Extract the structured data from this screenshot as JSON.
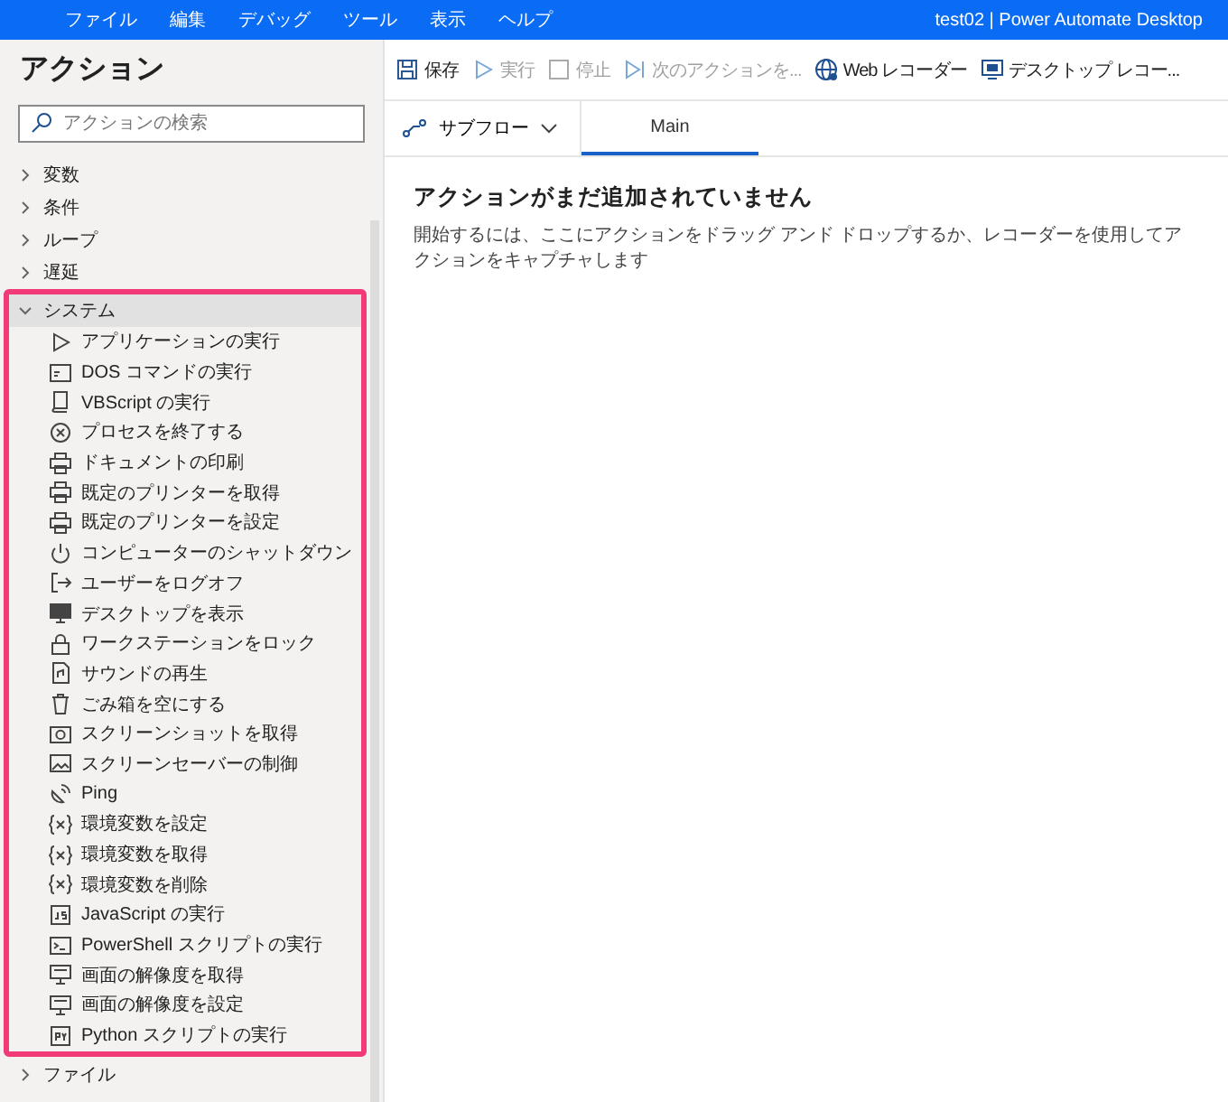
{
  "menu_bar": {
    "items": [
      "ファイル",
      "編集",
      "デバッグ",
      "ツール",
      "表示",
      "ヘルプ"
    ],
    "title": "test02 | Power Automate Desktop"
  },
  "sidebar": {
    "title": "アクション",
    "search": {
      "placeholder": "アクションの検索"
    },
    "categories": [
      {
        "label": "変数",
        "expanded": false,
        "highlighted": false
      },
      {
        "label": "条件",
        "expanded": false,
        "highlighted": false
      },
      {
        "label": "ループ",
        "expanded": false,
        "highlighted": false
      },
      {
        "label": "遅延",
        "expanded": false,
        "highlighted": false
      },
      {
        "label": "システム",
        "expanded": true,
        "highlighted": true,
        "children": [
          {
            "label": "アプリケーションの実行",
            "kind": "play"
          },
          {
            "label": "DOS コマンドの実行",
            "kind": "cmd"
          },
          {
            "label": "VBScript の実行",
            "kind": "script"
          },
          {
            "label": "プロセスを終了する",
            "kind": "close"
          },
          {
            "label": "ドキュメントの印刷",
            "kind": "printer"
          },
          {
            "label": "既定のプリンターを取得",
            "kind": "printer"
          },
          {
            "label": "既定のプリンターを設定",
            "kind": "printer"
          },
          {
            "label": "コンピューターのシャットダウン",
            "kind": "power"
          },
          {
            "label": "ユーザーをログオフ",
            "kind": "logout"
          },
          {
            "label": "デスクトップを表示",
            "kind": "monitor"
          },
          {
            "label": "ワークステーションをロック",
            "kind": "lock"
          },
          {
            "label": "サウンドの再生",
            "kind": "sound"
          },
          {
            "label": "ごみ箱を空にする",
            "kind": "trash"
          },
          {
            "label": "スクリーンショットを取得",
            "kind": "camera"
          },
          {
            "label": "スクリーンセーバーの制御",
            "kind": "image"
          },
          {
            "label": "Ping",
            "kind": "ping"
          },
          {
            "label": "環境変数を設定",
            "kind": "var"
          },
          {
            "label": "環境変数を取得",
            "kind": "var"
          },
          {
            "label": "環境変数を削除",
            "kind": "var"
          },
          {
            "label": "JavaScript の実行",
            "kind": "js"
          },
          {
            "label": "PowerShell スクリプトの実行",
            "kind": "terminal"
          },
          {
            "label": "画面の解像度を取得",
            "kind": "screen"
          },
          {
            "label": "画面の解像度を設定",
            "kind": "screen"
          },
          {
            "label": "Python スクリプトの実行",
            "kind": "py"
          }
        ]
      },
      {
        "label": "ファイル",
        "expanded": false,
        "highlighted": false
      }
    ]
  },
  "toolbar": [
    {
      "label": "保存",
      "kind": "save",
      "disabled": false
    },
    {
      "label": "実行",
      "kind": "run",
      "disabled": true
    },
    {
      "label": "停止",
      "kind": "stop",
      "disabled": true
    },
    {
      "label": "次のアクションを...",
      "kind": "next",
      "disabled": true
    },
    {
      "label": "Web レコーダー",
      "kind": "web",
      "disabled": false
    },
    {
      "label": "デスクトップ レコー...",
      "kind": "desktop",
      "disabled": false
    }
  ],
  "subflows": {
    "label": "サブフロー",
    "tabs": [
      {
        "label": "Main",
        "selected": true
      }
    ]
  },
  "canvas": {
    "heading": "アクションがまだ追加されていません",
    "hint": "開始するには、ここにアクションをドラッグ アンド ドロップするか、レコーダーを使用してアクションをキャプチャします"
  }
}
